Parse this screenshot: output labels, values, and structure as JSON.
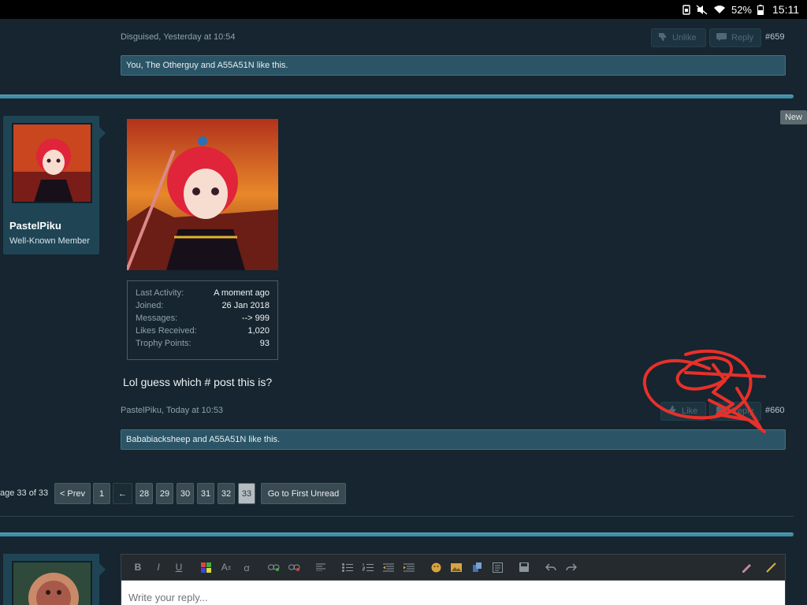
{
  "status_bar": {
    "battery": "52%",
    "time": "15:11"
  },
  "prev_post": {
    "meta": "Disguised, Yesterday at 10:54",
    "unlike_label": "Unlike",
    "reply_label": "Reply",
    "post_number": "#659",
    "likes_text": "You, The Otherguy and A55A51N like this."
  },
  "new_badge": "New",
  "post": {
    "username": "PastelPiku",
    "user_title": "Well-Known Member",
    "stats": [
      {
        "key": "Last Activity:",
        "value": "A moment ago"
      },
      {
        "key": "Joined:",
        "value": "26 Jan 2018"
      },
      {
        "key": "Messages:",
        "value": "--> 999"
      },
      {
        "key": "Likes Received:",
        "value": "1,020"
      },
      {
        "key": "Trophy Points:",
        "value": "93"
      }
    ],
    "message": "Lol guess which # post this is?",
    "meta": "PastelPiku, Today at 10:53",
    "like_label": "Like",
    "reply_label": "Reply",
    "post_number": "#660",
    "likes_text": "Bababiacksheep and A55A51N like this."
  },
  "pagination": {
    "label": "age 33 of 33",
    "prev": "< Prev",
    "first": "1",
    "skip": "←",
    "pages": [
      "28",
      "29",
      "30",
      "31",
      "32",
      "33"
    ],
    "current": "33",
    "first_unread": "Go to First Unread"
  },
  "editor": {
    "placeholder": "Write your reply..."
  },
  "colors": {
    "background": "#16252f",
    "accent": "#3f8ea8",
    "likes_bar": "#2b5566",
    "scribble": "#e8302a"
  }
}
